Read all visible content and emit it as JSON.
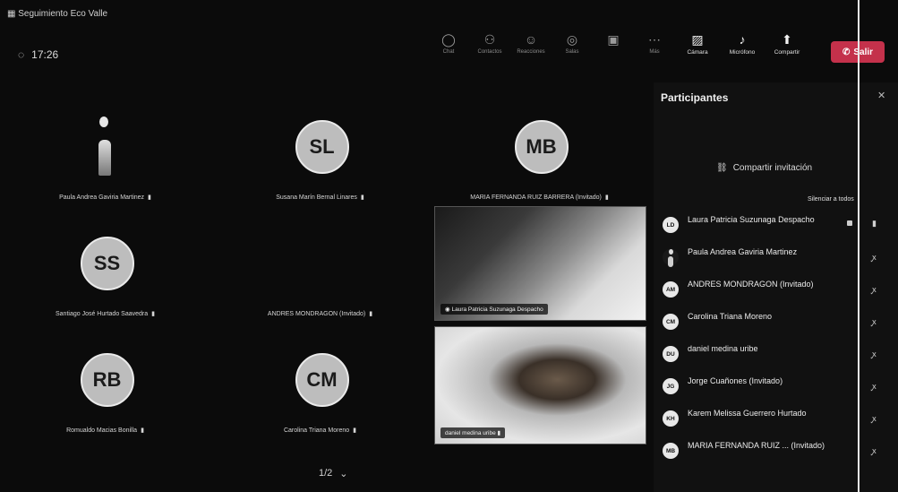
{
  "meeting": {
    "title": "Seguimiento Eco Valle",
    "elapsed": "17:26"
  },
  "toolbar": {
    "buttons": [
      {
        "label": "Chat",
        "icon": "chat-icon"
      },
      {
        "label": "Contactos",
        "icon": "people-icon"
      },
      {
        "label": "Reacciones",
        "icon": "emoji-icon"
      },
      {
        "label": "Salas",
        "icon": "rooms-icon"
      },
      {
        "label": "Más",
        "icon": "more-icon"
      },
      {
        "label": "Cámara",
        "icon": "camera-off-icon"
      },
      {
        "label": "Micrófono",
        "icon": "mic-icon"
      },
      {
        "label": "Compartir",
        "icon": "share-icon"
      }
    ],
    "leave_label": "Salir"
  },
  "grid": {
    "tiles": [
      {
        "name": "Paula Andrea Gaviria Martinez",
        "initials": ""
      },
      {
        "name": "Susana Marín Bernal Linares",
        "initials": "SL"
      },
      {
        "name": "MARIA FERNANDA RUIZ BARRERA (Invitado)",
        "initials": "MB"
      },
      {
        "name": "Santiago José Hurtado Saavedra",
        "initials": "SS"
      },
      {
        "name": "ANDRES MONDRAGON (Invitado)",
        "initials": ""
      },
      {
        "name": "Laura Patricia Suzunaga Despacho",
        "initials": ""
      },
      {
        "name": "Romualdo Macias Bonilla",
        "initials": "RB"
      },
      {
        "name": "Carolina Triana Moreno",
        "initials": "CM"
      },
      {
        "name": "daniel medina uribe",
        "initials": ""
      }
    ],
    "page": "1/2"
  },
  "participants": {
    "title": "Participantes",
    "invite_label": "Compartir invitación",
    "mute_all_label": "Silenciar a todos",
    "list": [
      {
        "initials": "LD",
        "name": "Laura Patricia Suzunaga Despacho",
        "sub": ""
      },
      {
        "initials": "",
        "name": "Paula Andrea Gaviria Martinez",
        "sub": ""
      },
      {
        "initials": "AM",
        "name": "ANDRES MONDRAGON (Invitado)",
        "sub": ""
      },
      {
        "initials": "CM",
        "name": "Carolina Triana Moreno",
        "sub": ""
      },
      {
        "initials": "DU",
        "name": "daniel medina uribe",
        "sub": ""
      },
      {
        "initials": "JG",
        "name": "Jorge Cuañones (Invitado)",
        "sub": ""
      },
      {
        "initials": "KH",
        "name": "Karem Melissa Guerrero Hurtado",
        "sub": ""
      },
      {
        "initials": "MB",
        "name": "MARIA FERNANDA RUIZ ... (Invitado)",
        "sub": ""
      }
    ]
  }
}
